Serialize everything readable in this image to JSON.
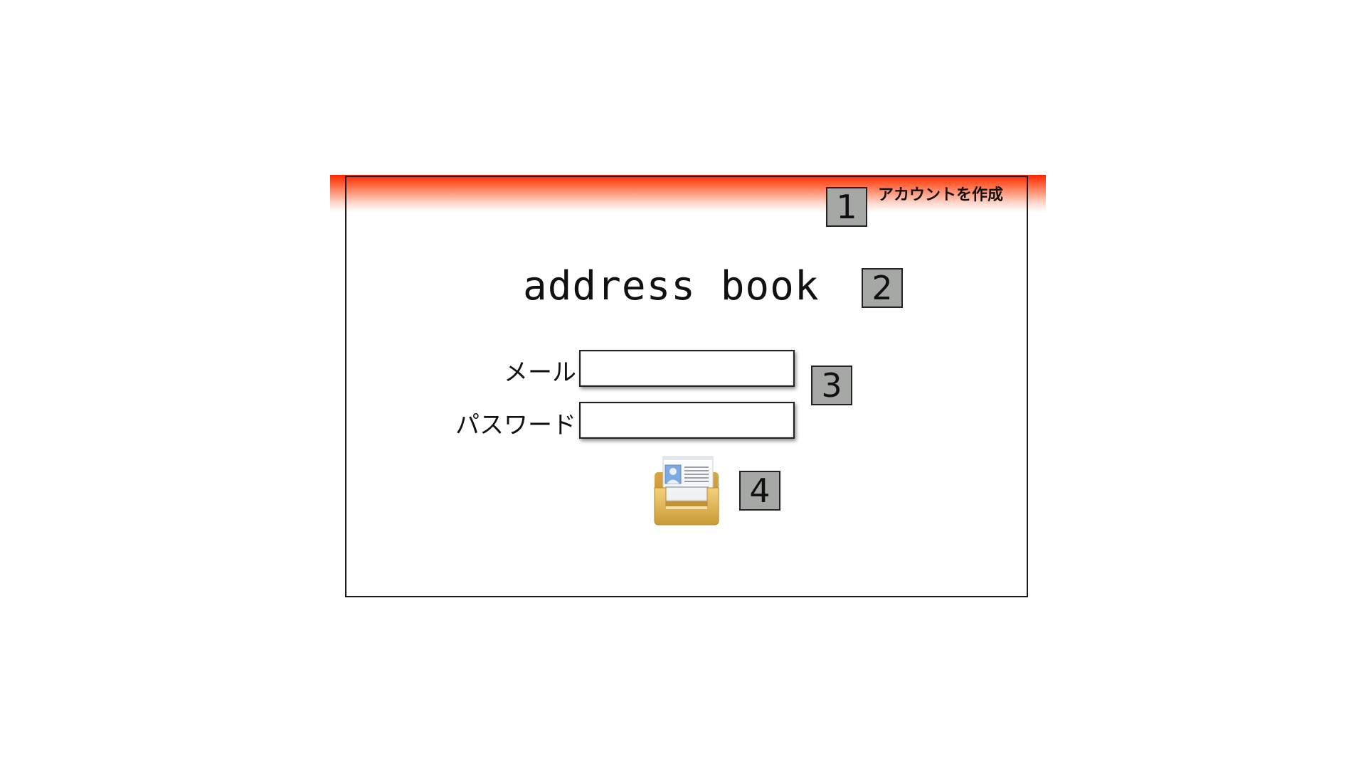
{
  "header": {
    "create_account_link": "アカウントを作成"
  },
  "markers": {
    "m1": "1",
    "m2": "2",
    "m3": "3",
    "m4": "4"
  },
  "logo": {
    "title": "address book"
  },
  "form": {
    "email_label": "メール",
    "email_value": "",
    "password_label": "パスワード",
    "password_value": ""
  },
  "icons": {
    "app_icon": "address-book-tray-icon"
  },
  "colors": {
    "header_accent": "#ff2400",
    "marker_fill": "#a6a8a6"
  }
}
